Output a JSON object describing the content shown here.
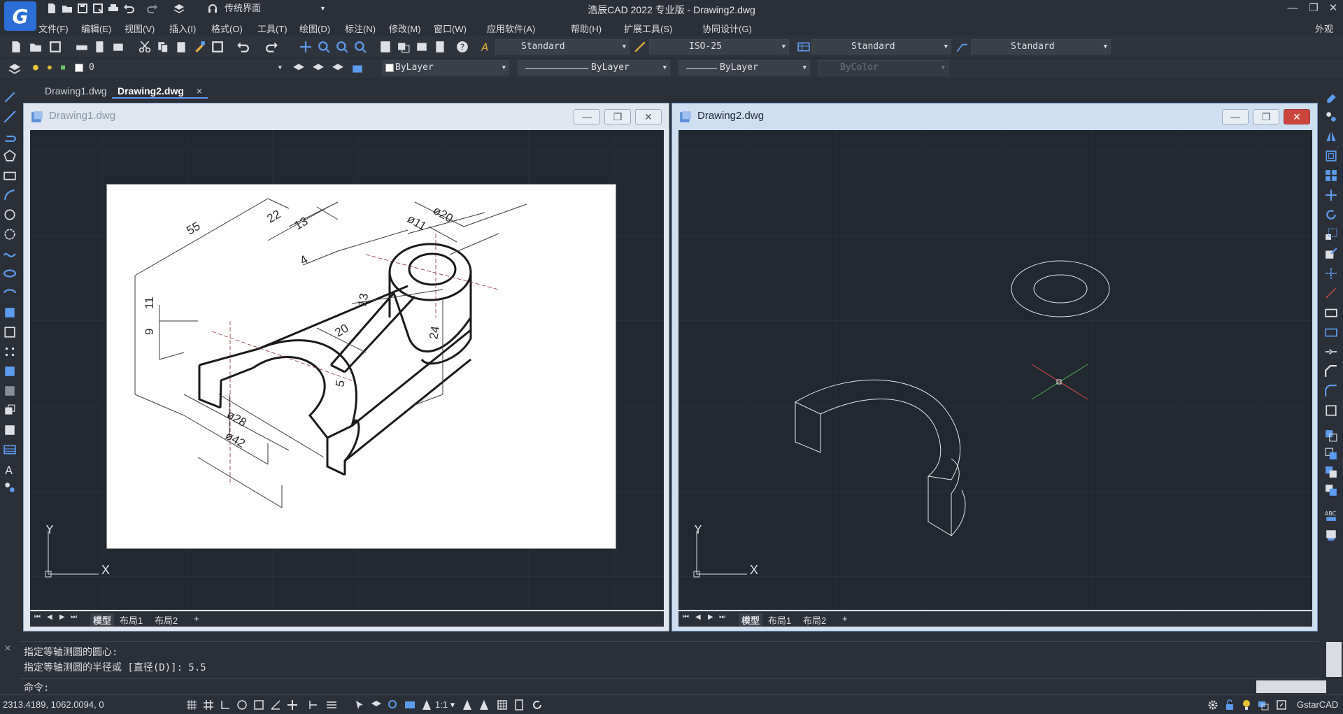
{
  "app": {
    "title": "浩辰CAD 2022 专业版 - Drawing2.dwg",
    "logo_letter": "G",
    "workspace": "传统界面",
    "top_right_menu": "外观"
  },
  "menu": [
    "文件(F)",
    "编辑(E)",
    "视图(V)",
    "插入(I)",
    "格式(O)",
    "工具(T)",
    "绘图(D)",
    "标注(N)",
    "修改(M)",
    "窗口(W)",
    "应用软件(A)",
    "帮助(H)",
    "扩展工具(S)",
    "协同设计(G)"
  ],
  "toolbar": {
    "text_style": "Standard",
    "dim_style": "ISO-25",
    "table_style": "Standard",
    "multileader_style": "Standard",
    "layer_name": "0",
    "color": "ByLayer",
    "linetype": "ByLayer",
    "lineweight": "ByLayer",
    "plot_style": "ByColor"
  },
  "doc_tabs": [
    {
      "label": "Drawing1.dwg",
      "active": false
    },
    {
      "label": "Drawing2.dwg",
      "active": true
    }
  ],
  "doc_tab_close": "×",
  "windows": [
    {
      "title": "Drawing1.dwg",
      "active": false
    },
    {
      "title": "Drawing2.dwg",
      "active": true
    }
  ],
  "window_buttons": {
    "minimize": "—",
    "restore": "❐",
    "close": "✕"
  },
  "layout_tabs": [
    "模型",
    "布局1",
    "布局2",
    "+"
  ],
  "axis": {
    "x": "X",
    "y": "Y"
  },
  "drawing1_dims": [
    "55",
    "22",
    "13",
    "4",
    "ø20",
    "ø11",
    "11",
    "9",
    "13",
    "20",
    "24",
    "5",
    "ø28",
    "ø42"
  ],
  "command": {
    "line1": "指定等轴测圆的圆心:",
    "line2": "指定等轴测圆的半径或 [直径(D)]: 5.5",
    "prompt": "命令:"
  },
  "status": {
    "coords": "2313.4189, 1062.0094, 0",
    "scale": "1:1",
    "brand": "GstarCAD"
  }
}
